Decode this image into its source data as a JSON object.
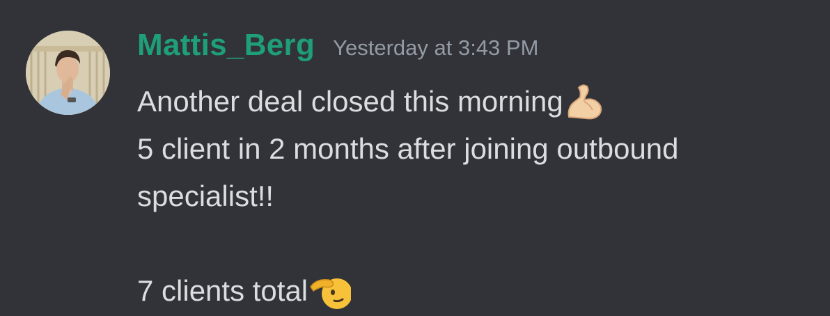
{
  "message": {
    "author": "Mattis_Berg",
    "timestamp": "Yesterday at 3:43 PM",
    "lines": [
      {
        "text": "Another deal closed this morning",
        "emoji": "flexed-biceps-icon"
      },
      {
        "text": "5 client in 2 months after joining outbound"
      },
      {
        "text": "specialist!!"
      },
      {
        "text": ""
      },
      {
        "text": "7 clients total",
        "emoji": "saluting-face-icon"
      }
    ]
  },
  "colors": {
    "background": "#313338",
    "author": "#1f9e7a",
    "timestamp": "#949ba4",
    "text": "#dbdee1"
  }
}
